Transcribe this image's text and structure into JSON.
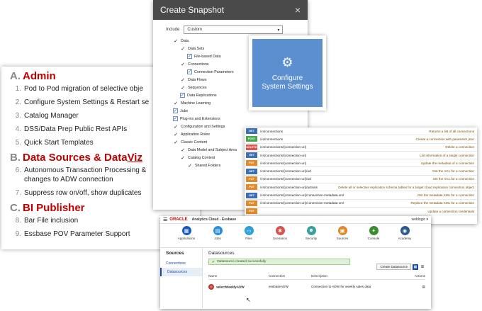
{
  "slide": {
    "sections": [
      {
        "letter": "A.",
        "title": "Admin",
        "title_underlined": "",
        "items": [
          {
            "num": "1.",
            "text": "Pod to Pod migration of selective obje"
          },
          {
            "num": "2.",
            "text": "Configure System Settings & Restart se"
          },
          {
            "num": "3.",
            "text": "Catalog Manager"
          },
          {
            "num": "4.",
            "text": "DSS/Data Prep Public Rest APIs"
          },
          {
            "num": "5.",
            "text": "Quick Start Templates"
          }
        ]
      },
      {
        "letter": "B.",
        "title": "Data Sources & Data ",
        "title_underlined": "Viz",
        "items": [
          {
            "num": "6.",
            "text": "Autonomous Transaction Processing &\nchanges to ADW connection"
          },
          {
            "num": "7.",
            "text": "Suppress row on/off, show duplicates"
          }
        ]
      },
      {
        "letter": "C.",
        "title": "BI Publisher",
        "title_underlined": "",
        "items": [
          {
            "num": "8.",
            "text": "Bar File inclusion"
          },
          {
            "num": "9.",
            "text": "Essbase POV Parameter Support"
          }
        ]
      }
    ]
  },
  "snapshot": {
    "title": "Create Snapshot",
    "close": "×",
    "include_label": "Include",
    "include_value": "Custom",
    "tree": [
      {
        "label": "Data",
        "level": 1,
        "type": "check"
      },
      {
        "label": "Data Sets",
        "level": 2,
        "type": "check"
      },
      {
        "label": "File-based Data",
        "level": 3,
        "type": "box"
      },
      {
        "label": "Connections",
        "level": 2,
        "type": "check"
      },
      {
        "label": "Connection Parameters",
        "level": 3,
        "type": "box"
      },
      {
        "label": "Data Flows",
        "level": 2,
        "type": "check"
      },
      {
        "label": "Sequences",
        "level": 2,
        "type": "check"
      },
      {
        "label": "Data Replications",
        "level": 2,
        "type": "box"
      },
      {
        "label": "Machine Learning",
        "level": 1,
        "type": "check"
      },
      {
        "label": "Jobs",
        "level": 1,
        "type": "box"
      },
      {
        "label": "Plug-ins and Extensions",
        "level": 1,
        "type": "box"
      },
      {
        "label": "Configuration and Settings",
        "level": 1,
        "type": "check"
      },
      {
        "label": "Application Roles",
        "level": 1,
        "type": "check"
      },
      {
        "label": "Classic Content",
        "level": 1,
        "type": "check"
      },
      {
        "label": "Data Model and Subject Area",
        "level": 2,
        "type": "check"
      },
      {
        "label": "Catalog Content",
        "level": 2,
        "type": "check"
      },
      {
        "label": "Shared Folders",
        "level": 3,
        "type": "check"
      }
    ]
  },
  "tile": {
    "label": "Configure\nSystem Settings",
    "icon": "gears-icon"
  },
  "api": {
    "rows": [
      {
        "method": "GET",
        "path": "/v4/connections",
        "desc": "Returns a list of all connections"
      },
      {
        "method": "POST",
        "path": "/v4/connections",
        "desc": "Create a connection with parameter json"
      },
      {
        "method": "DELETE",
        "path": "/v4/connections/{connection-uri}",
        "desc": "Delete a connection"
      },
      {
        "method": "GET",
        "path": "/v4/connections/{connection-uri}",
        "desc": "List information of a single connection"
      },
      {
        "method": "PUT",
        "path": "/v4/connections/{connection-uri}",
        "desc": "Update the metadata of a connection"
      },
      {
        "method": "GET",
        "path": "/v4/connections/{connection-uri}/acl",
        "desc": "Get the ACL for a connection"
      },
      {
        "method": "PUT",
        "path": "/v4/connections/{connection-uri}/acl",
        "desc": "Set the ACL for a connection"
      },
      {
        "method": "PUT",
        "path": "/v4/connections/{connection-uri}/actions",
        "desc": "Delete all or selective replication schema tables for a target cloud replication connection object"
      },
      {
        "method": "GET",
        "path": "/v4/connections/{connection-uri}/connection-metadata-xml",
        "desc": "Get the metadata XML for a connection"
      },
      {
        "method": "PUT",
        "path": "/v4/connections/{connection-uri}/connection-metadata-xml",
        "desc": "Replace the metadata XML for a connection"
      },
      {
        "method": "PUT",
        "path": "",
        "desc": "Update a connection credentials"
      }
    ],
    "colors": {
      "GET": "#3b6fb6",
      "POST": "#49a84a",
      "DELETE": "#d9534f",
      "PUT": "#e08a2c"
    }
  },
  "oac": {
    "brand": "ORACLE",
    "app_name": "Analytics Cloud - Essbase",
    "user": "weblogic ▾",
    "nav": [
      {
        "label": "Applications",
        "icon": "applications-icon",
        "glyph": "▦",
        "color": "#1a5bb8"
      },
      {
        "label": "Jobs",
        "icon": "jobs-icon",
        "glyph": "▤",
        "color": "#2b8fd8"
      },
      {
        "label": "Files",
        "icon": "files-icon",
        "glyph": "▭",
        "color": "#2b9fd8"
      },
      {
        "label": "Scenarios",
        "icon": "scenarios-icon",
        "glyph": "✱",
        "color": "#d9534f"
      },
      {
        "label": "Security",
        "icon": "security-icon",
        "glyph": "☻",
        "color": "#3aa0a0"
      },
      {
        "label": "Sources",
        "icon": "sources-icon",
        "glyph": "▣",
        "color": "#e08a2c"
      },
      {
        "label": "Console",
        "icon": "console-icon",
        "glyph": "✦",
        "color": "#3a8d2a"
      },
      {
        "label": "Academy",
        "icon": "academy-icon",
        "glyph": "◉",
        "color": "#2c5a8a"
      }
    ],
    "sidebar": {
      "title": "Sources",
      "items": [
        "Connections",
        "Datasources"
      ],
      "active": 1
    },
    "main": {
      "title": "Datasources",
      "toast": "Datasource created successfully",
      "create_button": "Create Datasource",
      "columns": {
        "name": "Name",
        "connection": "Connection",
        "description": "Description",
        "actions": "Actions"
      },
      "row": {
        "name": "selectWeeklyADW",
        "connection": "essbaseADW",
        "description": "Connection to ADW for weekly sales data"
      }
    }
  }
}
